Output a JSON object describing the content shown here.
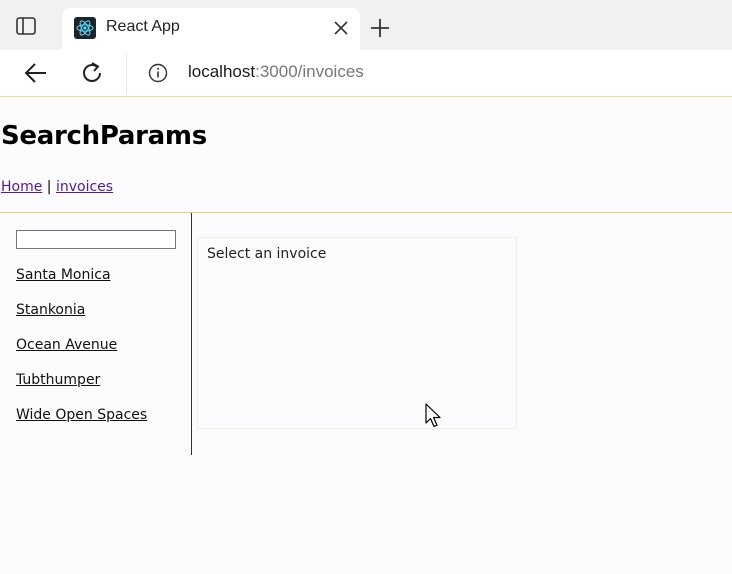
{
  "browser": {
    "tab": {
      "title": "React App"
    },
    "address": {
      "host": "localhost",
      "path": ":3000/invoices"
    },
    "icons": {
      "tab_actions": "tab-actions-icon",
      "favicon": "react-logo-icon",
      "close": "close-icon",
      "new_tab": "plus-icon",
      "back": "back-arrow-icon",
      "reload": "reload-icon",
      "site_info": "info-icon"
    },
    "colors": {
      "react_accent": "#61dafb"
    }
  },
  "page": {
    "title": "SearchParams",
    "nav": {
      "home": "Home",
      "separator": " | ",
      "invoices": "invoices"
    },
    "search": {
      "value": "",
      "placeholder": ""
    },
    "invoices": [
      {
        "label": "Santa Monica"
      },
      {
        "label": "Stankonia"
      },
      {
        "label": "Ocean Avenue"
      },
      {
        "label": "Tubthumper"
      },
      {
        "label": "Wide Open Spaces"
      }
    ],
    "main": {
      "placeholder": "Select an invoice"
    },
    "colors": {
      "visited_link": "#551a8b"
    }
  }
}
